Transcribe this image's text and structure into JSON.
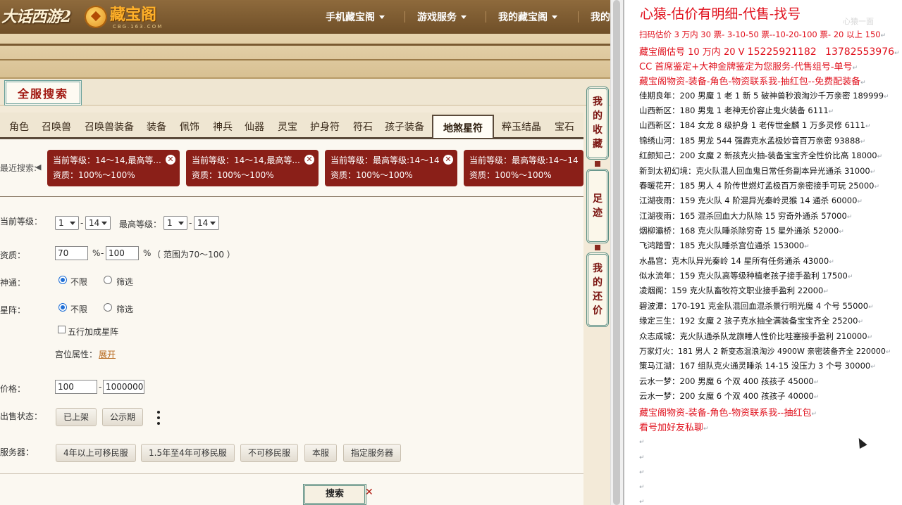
{
  "site": {
    "logo_game": "大话西游2",
    "logo_brand": "藏宝阁",
    "logo_url": "CBG.163.COM",
    "nav": [
      {
        "label": "手机藏宝阁"
      },
      {
        "label": "游戏服务"
      },
      {
        "label": "我的藏宝阁"
      },
      {
        "label": "我的"
      }
    ],
    "section_title": "全服搜索",
    "tabs": [
      {
        "label": "角色"
      },
      {
        "label": "召唤兽"
      },
      {
        "label": "召唤兽装备"
      },
      {
        "label": "装备"
      },
      {
        "label": "佩饰"
      },
      {
        "label": "神兵"
      },
      {
        "label": "仙器"
      },
      {
        "label": "灵宝"
      },
      {
        "label": "护身符"
      },
      {
        "label": "符石"
      },
      {
        "label": "孩子装备"
      },
      {
        "label": "地煞星符"
      },
      {
        "label": "粹玉结晶"
      },
      {
        "label": "宝石"
      }
    ],
    "active_tab": "地煞星符",
    "recent_label": "最近搜索:",
    "recent": [
      {
        "line1": "当前等级：14～14,最高等...",
        "line2": "资质：100%～100%"
      },
      {
        "line1": "当前等级：14～14,最高等...",
        "line2": "资质：100%～100%"
      },
      {
        "line1": "当前等级：最高等级:14～14",
        "line2": "资质：100%～100%"
      },
      {
        "line1": "当前等级：最高等级:14～14",
        "line2": "资质：100%～100%"
      }
    ],
    "filters": {
      "level_label": "当前等级：",
      "level_min": "1",
      "level_max": "14",
      "max_level_label": "最高等级：",
      "max_min": "1",
      "max_max": "14",
      "quality_label": "资质：",
      "quality_min": "70",
      "quality_max": "100",
      "quality_unit": "%",
      "quality_hint": "（ 范围为70～100 ）",
      "shentong_label": "神通：",
      "xingzhen_label": "星阵：",
      "opt_any": "不限",
      "opt_filter": "筛选",
      "wuxing_label": "五行加成星阵",
      "gongwei_label": "宫位属性：",
      "gongwei_link": "展开",
      "price_label": "价格：",
      "price_min": "100",
      "price_max": "1000000",
      "sale_label": "出售状态：",
      "sale_opts": [
        {
          "label": "已上架"
        },
        {
          "label": "公示期"
        }
      ],
      "server_label": "服务器：",
      "server_opts": [
        {
          "label": "4年以上可移民服"
        },
        {
          "label": "1.5年至4年可移民服"
        },
        {
          "label": "不可移民服"
        },
        {
          "label": "本服"
        },
        {
          "label": "指定服务器"
        }
      ]
    },
    "search_button": "搜索",
    "side_buttons": [
      "我的收藏",
      "足迹",
      "我的还价"
    ]
  },
  "doc": {
    "title": "心猿-估价有明细-代售-找号",
    "watermark": "心猿一面",
    "header_lines": [
      "扫码估价 3 万内 30 票- 3-10-50 票--10-20-100 票- 20 以上 150",
      "CC 首席鉴定+大神金牌鉴定为您服务-代售组号-单号",
      "藏宝阁物资-装备-角色-物资联系我-抽红包--免费配装备"
    ],
    "phone_line_prefix": "藏宝阁估号 10 万内 20 V",
    "phone_1": "15225921182",
    "phone_2": "13782553976",
    "listings": [
      "佳期良年：200 男魔 1 老 1 新 5 破神兽秒浪淘沙千万亲密 189999",
      "山西新区：180 男鬼 1 老神无价容止鬼火装备 6111",
      "山西新区：184 女龙 8 级护身 1 老传世金麟 1 万多灵修 6111",
      "锦绣山河：185 男龙 544 强霹克水孟极妙音百万亲密 93888",
      "红颜知己：200 女魔 2 新孩克火抽-装备宝宝齐全性价比高 18000",
      "新到太初幻境：克火队混人回血鬼日常任务副本异光通杀 31000",
      "春暖花开：185 男人 4 阶传世燃灯孟极百万亲密接手可玩 25000",
      "江湖夜雨：159 克火队 4 阶混异光秦岭灵猴 14 通杀 60000",
      "江湖夜雨：165 混杀回血大力队除 15 穷奇外通杀 57000",
      "烟柳灞桥：168 克火队睡杀除穷奇 15 星外通杀 52000",
      "飞鸿踏雪：185 克火队睡杀宫位通杀 153000",
      "水晶宫：克木队异光秦岭 14 星所有任务通杀 43000",
      "似水流年：159 克火队高等级种植老孩子接手盈利 17500",
      "凌烟阁：159 克火队畜牧符文职业接手盈利 22000",
      "碧波潭：170-191 克金队混回血混杀景行明光魔 4 个号 55000",
      "缘定三生：192 女魔 2 孩子克水抽全满装备宝宝齐全 25200",
      "众志成城：克火队通杀队龙旗睡人性价比哇塞接手盈利 210000",
      "万家灯火：181 男人 2 新变态混浪淘沙 4900W 亲密装备齐全 220000",
      "策马江湖：167 组队克火通灵睡杀 14-15 没压力 3 个号 30000",
      "云水一梦：200 男魔 6 个双 400 孩孩子 45000",
      "云水一梦：200 女魔 6 个双 400 孩孩子 40000"
    ],
    "footer_lines": [
      "藏宝阁物资-装备-角色-物资联系我--抽红包",
      "看号加好友私聊"
    ],
    "para_mark": "↵"
  }
}
